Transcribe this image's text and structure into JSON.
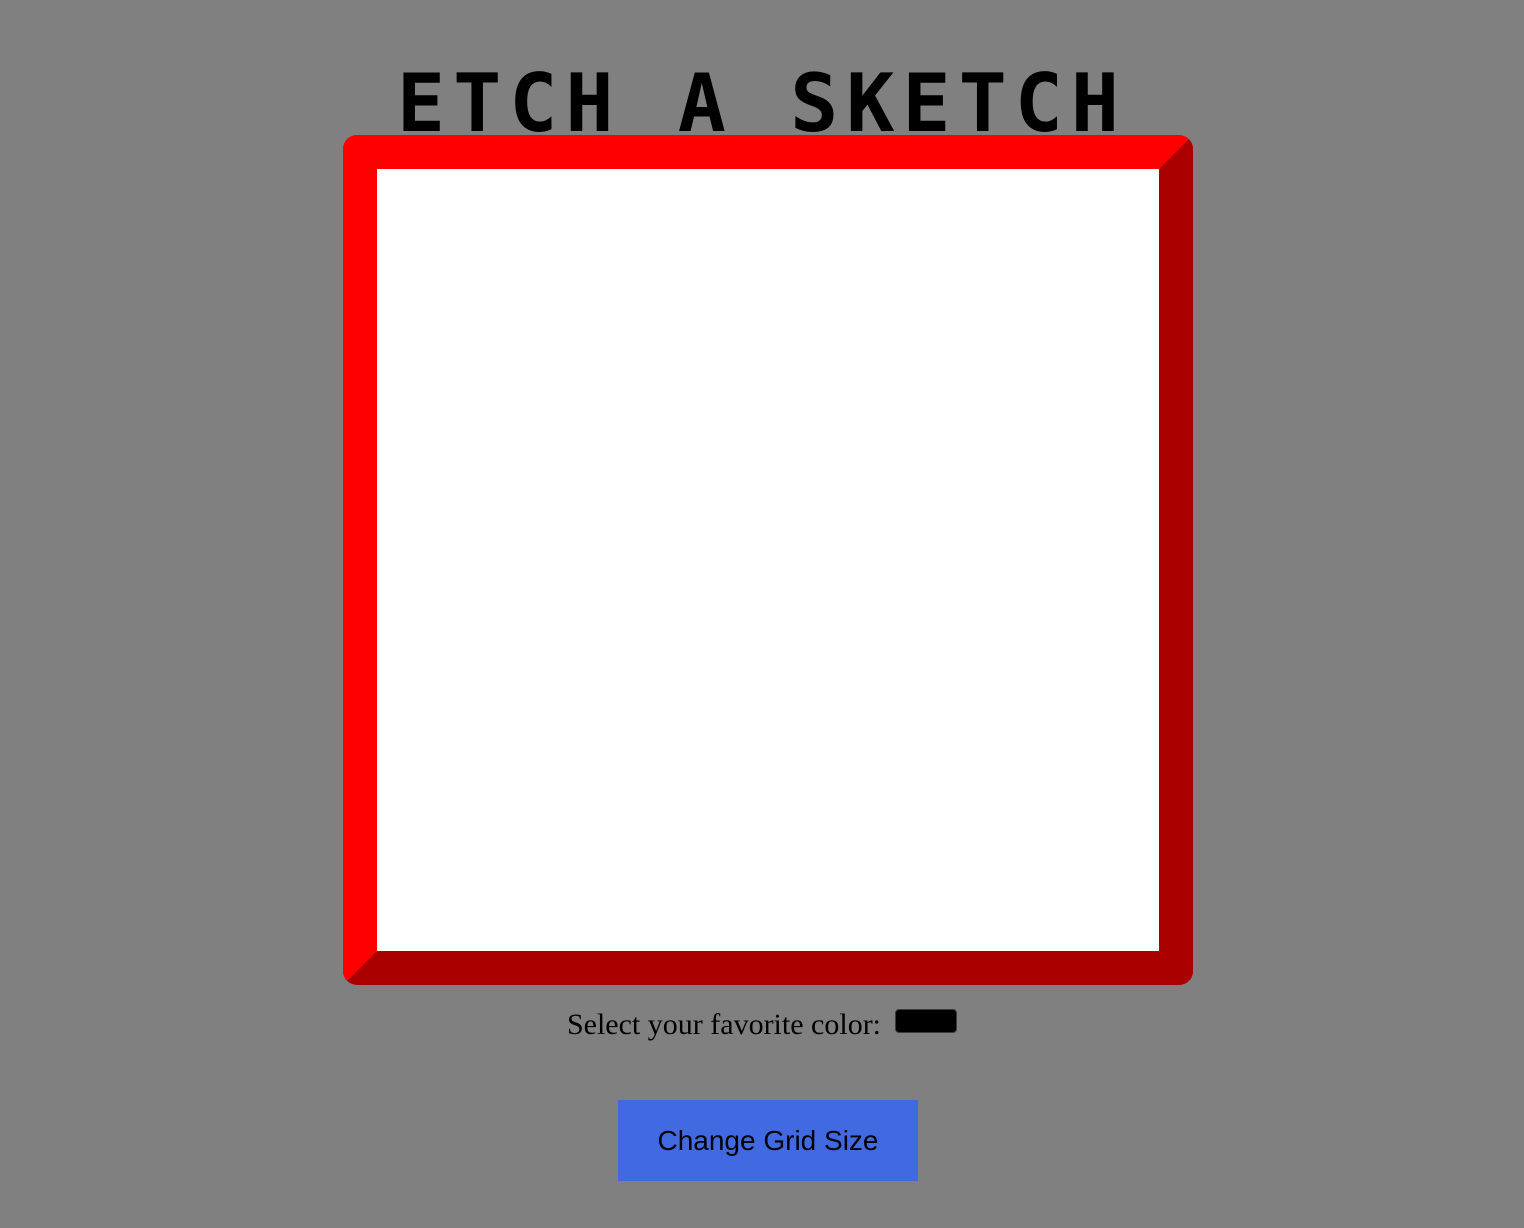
{
  "header": {
    "title": "Etch A Sketch"
  },
  "frame": {
    "light_color": "#ff0000",
    "dark_color": "#aa0000",
    "canvas_color": "#ffffff"
  },
  "controls": {
    "color_label": "Select your favorite color:",
    "selected_color": "#000000",
    "grid_button_label": "Change Grid Size",
    "grid_button_color": "#4169e1"
  },
  "page": {
    "background_color": "#808080"
  }
}
